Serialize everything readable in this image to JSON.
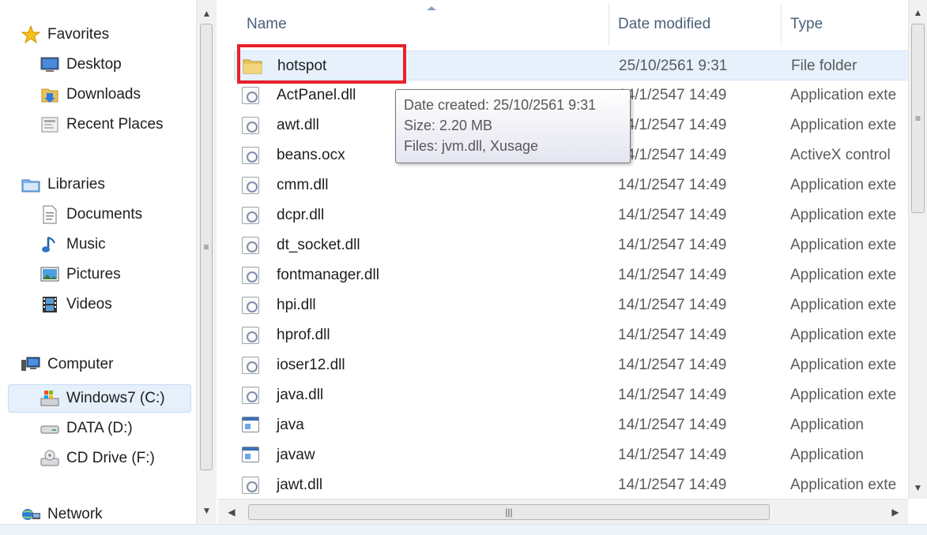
{
  "nav": {
    "items": [
      {
        "label": "Favorites",
        "icon": "star-icon"
      },
      {
        "label": "Desktop",
        "icon": "desktop-icon"
      },
      {
        "label": "Downloads",
        "icon": "downloads-folder-icon"
      },
      {
        "label": "Recent Places",
        "icon": "recent-places-icon"
      },
      {
        "label": "Libraries",
        "icon": "libraries-icon"
      },
      {
        "label": "Documents",
        "icon": "documents-icon"
      },
      {
        "label": "Music",
        "icon": "music-note-icon"
      },
      {
        "label": "Pictures",
        "icon": "pictures-icon"
      },
      {
        "label": "Videos",
        "icon": "videos-icon"
      },
      {
        "label": "Computer",
        "icon": "computer-icon"
      },
      {
        "label": "Windows7 (C:)",
        "icon": "system-drive-icon"
      },
      {
        "label": "DATA (D:)",
        "icon": "hard-drive-icon"
      },
      {
        "label": "CD Drive (F:)",
        "icon": "cd-drive-icon"
      },
      {
        "label": "Network",
        "icon": "network-icon"
      }
    ],
    "selected": "Windows7 (C:)"
  },
  "columns": {
    "name": "Name",
    "date": "Date modified",
    "type": "Type"
  },
  "files": [
    {
      "name": "hotspot",
      "date": "25/10/2561 9:31",
      "type": "File folder",
      "icon": "folder-icon"
    },
    {
      "name": "ActPanel.dll",
      "date": "14/1/2547 14:49",
      "type": "Application exte",
      "icon": "dll-icon"
    },
    {
      "name": "awt.dll",
      "date": "14/1/2547 14:49",
      "type": "Application exte",
      "icon": "dll-icon"
    },
    {
      "name": "beans.ocx",
      "date": "14/1/2547 14:49",
      "type": "ActiveX control",
      "icon": "dll-icon"
    },
    {
      "name": "cmm.dll",
      "date": "14/1/2547 14:49",
      "type": "Application exte",
      "icon": "dll-icon"
    },
    {
      "name": "dcpr.dll",
      "date": "14/1/2547 14:49",
      "type": "Application exte",
      "icon": "dll-icon"
    },
    {
      "name": "dt_socket.dll",
      "date": "14/1/2547 14:49",
      "type": "Application exte",
      "icon": "dll-icon"
    },
    {
      "name": "fontmanager.dll",
      "date": "14/1/2547 14:49",
      "type": "Application exte",
      "icon": "dll-icon"
    },
    {
      "name": "hpi.dll",
      "date": "14/1/2547 14:49",
      "type": "Application exte",
      "icon": "dll-icon"
    },
    {
      "name": "hprof.dll",
      "date": "14/1/2547 14:49",
      "type": "Application exte",
      "icon": "dll-icon"
    },
    {
      "name": "ioser12.dll",
      "date": "14/1/2547 14:49",
      "type": "Application exte",
      "icon": "dll-icon"
    },
    {
      "name": "java.dll",
      "date": "14/1/2547 14:49",
      "type": "Application exte",
      "icon": "dll-icon"
    },
    {
      "name": "java",
      "date": "14/1/2547 14:49",
      "type": "Application",
      "icon": "exe-icon"
    },
    {
      "name": "javaw",
      "date": "14/1/2547 14:49",
      "type": "Application",
      "icon": "exe-icon"
    },
    {
      "name": "jawt.dll",
      "date": "14/1/2547 14:49",
      "type": "Application exte",
      "icon": "dll-icon"
    }
  ],
  "tooltip": {
    "line1": "Date created: 25/10/2561 9:31",
    "line2": "Size: 2.20 MB",
    "line3": "Files: jvm.dll, Xusage"
  },
  "colors": {
    "highlight": "#e8202a",
    "selection": "#e6f1fc",
    "header_text": "#4c607a"
  }
}
